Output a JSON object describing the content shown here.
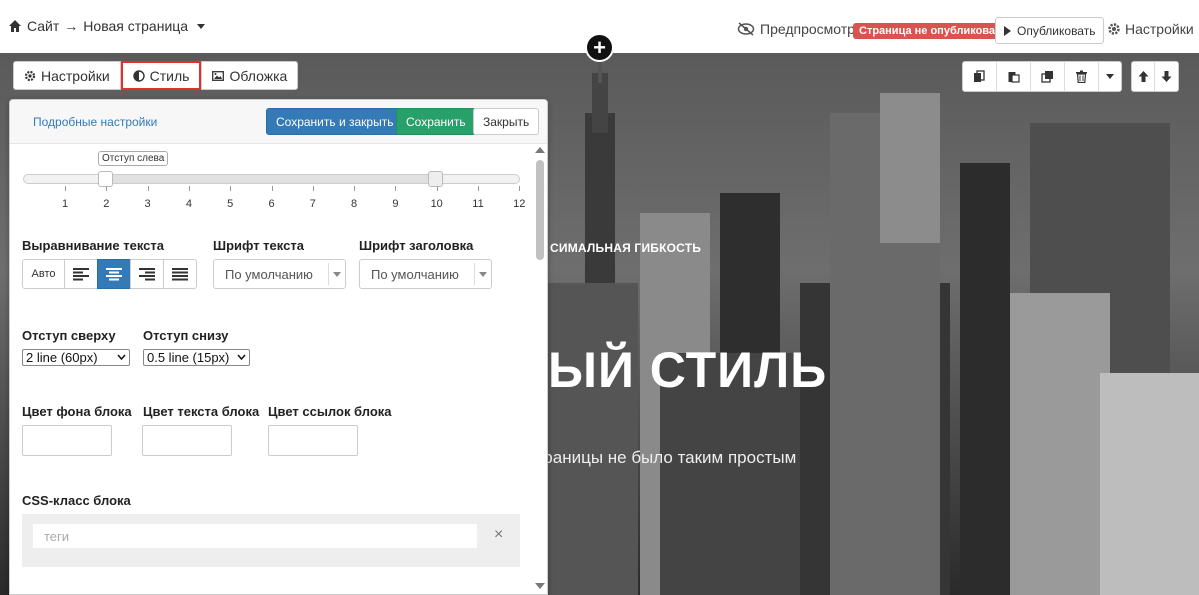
{
  "topbar": {
    "breadcrumb_site": "Сайт",
    "breadcrumb_arrow": "→",
    "breadcrumb_page": "Новая страница",
    "preview_label": "Предпросмотр",
    "status_badge": "Страница не опубликована",
    "publish_label": "Опубликовать",
    "settings_label": "Настройки"
  },
  "tabs": [
    {
      "label": "Настройки",
      "icon": "gear-icon"
    },
    {
      "label": "Стиль",
      "icon": "contrast-icon",
      "active": true
    },
    {
      "label": "Обложка",
      "icon": "image-icon"
    }
  ],
  "panel": {
    "advanced_link": "Подробные настройки",
    "save_close_label": "Сохранить и закрыть",
    "save_label": "Сохранить",
    "close_label": "Закрыть",
    "slider": {
      "tooltip": "Отступ слева",
      "ticks": [
        "1",
        "2",
        "3",
        "4",
        "5",
        "6",
        "7",
        "8",
        "9",
        "10",
        "11",
        "12"
      ],
      "start_value": 2,
      "end_value": 10
    },
    "text_align_label": "Выравнивание текста",
    "text_align_auto": "Авто",
    "text_align_selected": "center",
    "font_text_label": "Шрифт текста",
    "font_text_value": "По умолчанию",
    "font_heading_label": "Шрифт заголовка",
    "font_heading_value": "По умолчанию",
    "padding_top_label": "Отступ сверху",
    "padding_top_value": "2 line (60px)",
    "padding_bottom_label": "Отступ снизу",
    "padding_bottom_value": "0.5 line (15px)",
    "bg_color_label": "Цвет фона блока",
    "text_color_label": "Цвет текста блока",
    "link_color_label": "Цвет ссылок блока",
    "css_class_label": "CSS-класс блока",
    "tags_placeholder": "теги",
    "tags_clear": "×"
  },
  "hero": {
    "kicker": "СИМАЛЬНАЯ ГИБКОСТЬ",
    "title": "ЫЙ СТИЛЬ",
    "subtitle": "страницы не было таким простым"
  },
  "colors": {
    "primary": "#337ab7",
    "success": "#28a06a",
    "danger": "#d9534f",
    "highlight": "#e03030"
  }
}
